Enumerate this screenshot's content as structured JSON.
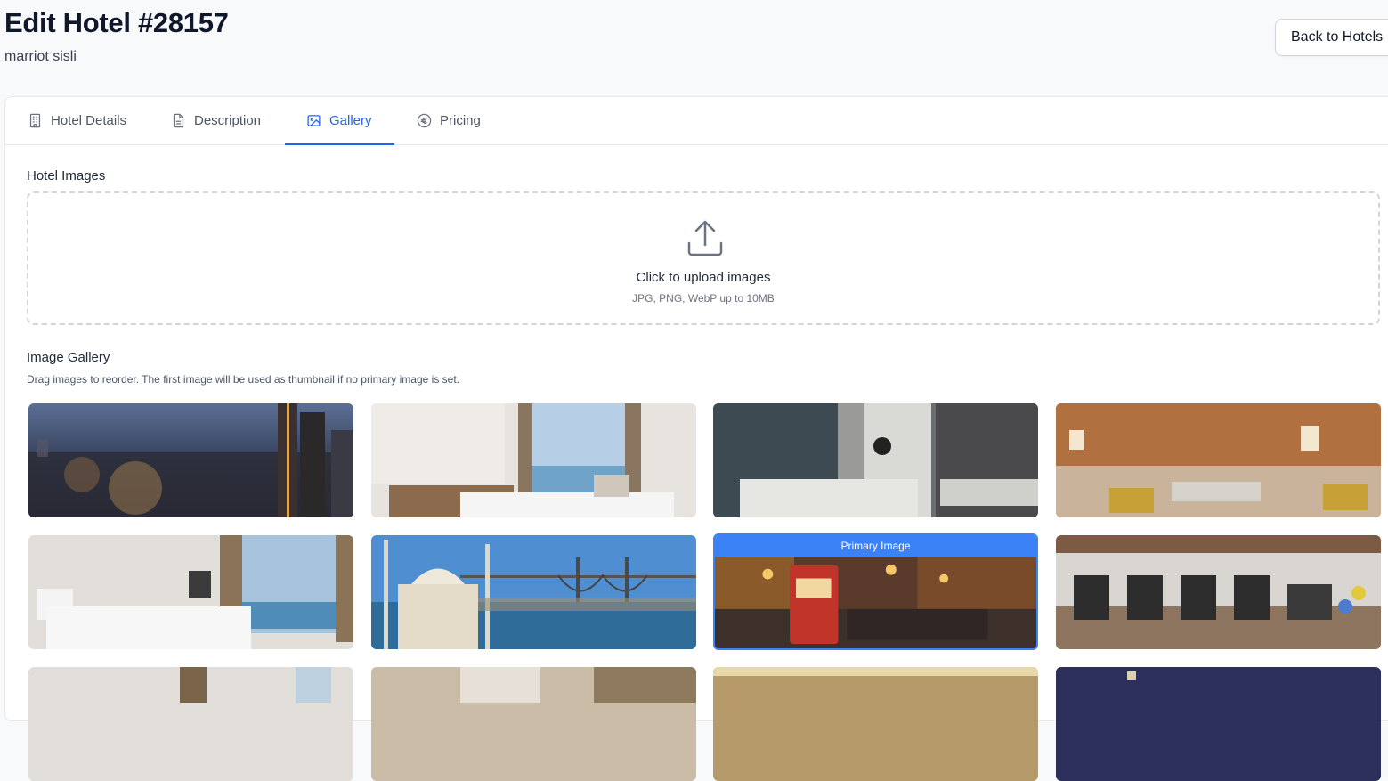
{
  "header": {
    "title": "Edit Hotel #28157",
    "subtitle": "marriot sisli",
    "back_label": "Back to Hotels"
  },
  "tabs": [
    {
      "label": "Hotel Details",
      "icon": "building-icon",
      "active": false
    },
    {
      "label": "Description",
      "icon": "document-icon",
      "active": false
    },
    {
      "label": "Gallery",
      "icon": "image-icon",
      "active": true
    },
    {
      "label": "Pricing",
      "icon": "euro-icon",
      "active": false
    }
  ],
  "upload": {
    "section_label": "Hotel Images",
    "title": "Click to upload images",
    "hint": "JPG, PNG, WebP up to 10MB"
  },
  "gallery": {
    "section_label": "Image Gallery",
    "hint": "Drag images to reorder. The first image will be used as thumbnail if no primary image is set.",
    "primary_badge": "Primary Image",
    "images": [
      {
        "subject": "city skyline at night",
        "primary": false
      },
      {
        "subject": "hotel room with sea view",
        "primary": false
      },
      {
        "subject": "marble bathroom",
        "primary": false
      },
      {
        "subject": "lobby lounge",
        "primary": false
      },
      {
        "subject": "bedroom with panoramic window",
        "primary": false
      },
      {
        "subject": "mosque and bosphorus bridge",
        "primary": false
      },
      {
        "subject": "red tram on istiklal street",
        "primary": true
      },
      {
        "subject": "fitness center",
        "primary": false
      },
      {
        "subject": "room interior",
        "primary": false
      },
      {
        "subject": "room interior",
        "primary": false
      },
      {
        "subject": "hallway",
        "primary": false
      },
      {
        "subject": "night exterior",
        "primary": false
      }
    ]
  },
  "colors": {
    "accent": "#2563eb",
    "primary_badge": "#3b82f6"
  }
}
